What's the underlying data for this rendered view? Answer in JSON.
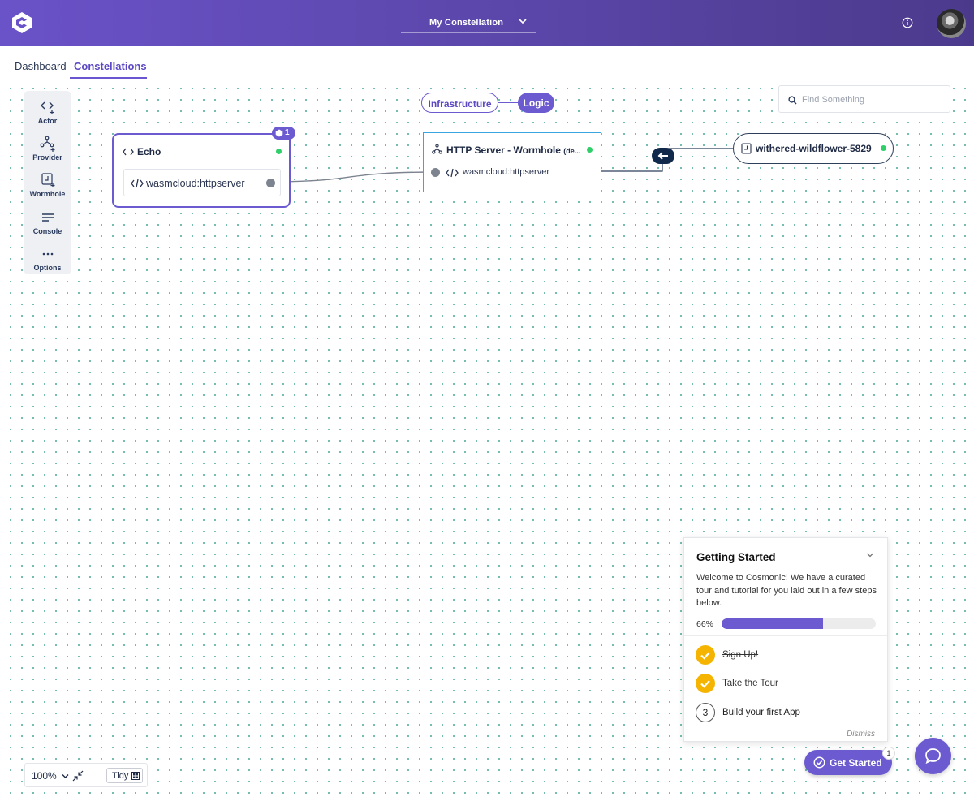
{
  "header": {
    "constellation_name": "My Constellation"
  },
  "nav": {
    "tabs": [
      {
        "label": "Dashboard",
        "active": false
      },
      {
        "label": "Constellations",
        "active": true
      }
    ]
  },
  "toolbox": {
    "items": [
      {
        "label": "Actor",
        "icon": "actor-add-icon"
      },
      {
        "label": "Provider",
        "icon": "provider-add-icon"
      },
      {
        "label": "Wormhole",
        "icon": "wormhole-add-icon"
      },
      {
        "label": "Console",
        "icon": "console-icon"
      },
      {
        "label": "Options",
        "icon": "more-icon"
      }
    ]
  },
  "search": {
    "placeholder": "Find Something"
  },
  "layers": {
    "infrastructure": "Infrastructure",
    "logic": "Logic"
  },
  "nodes": {
    "echo": {
      "title": "Echo",
      "badge_count": "1",
      "port_label": "wasmcloud:httpserver"
    },
    "http_server": {
      "title": "HTTP Server - Wormhole",
      "title_suffix": "(de...",
      "port_label": "wasmcloud:httpserver"
    },
    "wormhole": {
      "title": "withered-wildflower-5829"
    }
  },
  "zoom": {
    "value": "100%",
    "tidy_label": "Tidy"
  },
  "getting_started": {
    "title": "Getting Started",
    "description": "Welcome to Cosmonic! We have a curated tour and tutorial for you laid out in a few steps below.",
    "progress_label": "66%",
    "progress": 0.66,
    "steps": [
      {
        "label": "Sign Up!",
        "done": true
      },
      {
        "label": "Take the Tour",
        "done": true
      },
      {
        "number": "3",
        "label": "Build your first App",
        "done": false
      }
    ],
    "dismiss": "Dismiss"
  },
  "get_started_button": {
    "label": "Get Started",
    "count": "1"
  },
  "colors": {
    "brand": "#6b5ad0",
    "status_ok": "#2fcf6a",
    "step_done": "#f5b400",
    "http_border": "#3aa6e0"
  }
}
